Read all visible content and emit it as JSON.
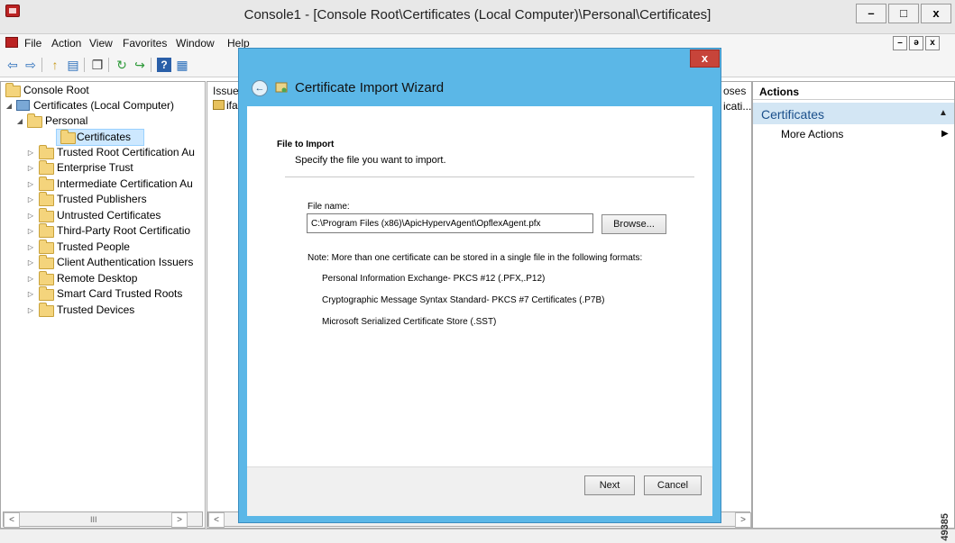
{
  "window": {
    "title": "Console1 - [Console Root\\Certificates (Local Computer)\\Personal\\Certificates]",
    "min_glyph": "–",
    "max_glyph": "□",
    "close_glyph": "x"
  },
  "menu": {
    "items": [
      "File",
      "Action",
      "View",
      "Favorites",
      "Window",
      "Help"
    ],
    "mdi_min": "–",
    "mdi_restore": "ə",
    "mdi_close": "x"
  },
  "toolbar": {
    "icons": [
      "back-arrow-icon",
      "forward-arrow-icon",
      "up-folder-icon",
      "show-hide-tree-icon",
      "copy-icon",
      "refresh-icon",
      "export-list-icon",
      "help-icon",
      "properties-icon"
    ],
    "glyphs": [
      "⇦",
      "⇨",
      "↑",
      "▤",
      "❐",
      "↻",
      "↪",
      "?",
      "▦"
    ]
  },
  "tree": {
    "items": [
      {
        "label": "Console Root"
      },
      {
        "label": "Certificates (Local Computer)"
      },
      {
        "label": "Personal"
      },
      {
        "label": "Certificates"
      },
      {
        "label": "Trusted Root Certification Au"
      },
      {
        "label": "Enterprise Trust"
      },
      {
        "label": "Intermediate Certification Au"
      },
      {
        "label": "Trusted Publishers"
      },
      {
        "label": "Untrusted Certificates"
      },
      {
        "label": "Third-Party Root Certificatio"
      },
      {
        "label": "Trusted People"
      },
      {
        "label": "Client Authentication Issuers"
      },
      {
        "label": "Remote Desktop"
      },
      {
        "label": "Smart Card Trusted Roots"
      },
      {
        "label": "Trusted Devices"
      }
    ]
  },
  "scroll": {
    "left": "<",
    "right": ">",
    "thumb": "III"
  },
  "middle": {
    "col_issued": "Issued",
    "row_issued": "ifa",
    "col_purposes": "oses",
    "row_purposes": "icati..."
  },
  "actions": {
    "header": "Actions",
    "group": "Certificates",
    "group_arrow": "▲",
    "more": "More Actions",
    "more_arrow": "▶"
  },
  "dialog": {
    "close_glyph": "x",
    "back_glyph": "←",
    "title": "Certificate Import Wizard",
    "section_heading": "File to Import",
    "section_desc": "Specify the file you want to import.",
    "file_label": "File name:",
    "file_value": "C:\\Program Files (x86)\\ApicHypervAgent\\OpflexAgent.pfx",
    "browse_label": "Browse...",
    "note": "Note:  More than one certificate can be stored in a single file in the following formats:",
    "formats": [
      "Personal Information Exchange- PKCS #12 (.PFX,.P12)",
      "Cryptographic Message Syntax Standard- PKCS #7 Certificates (.P7B)",
      "Microsoft Serialized Certificate Store (.SST)"
    ],
    "next_label": "Next",
    "cancel_label": "Cancel"
  },
  "side_number": "49385"
}
